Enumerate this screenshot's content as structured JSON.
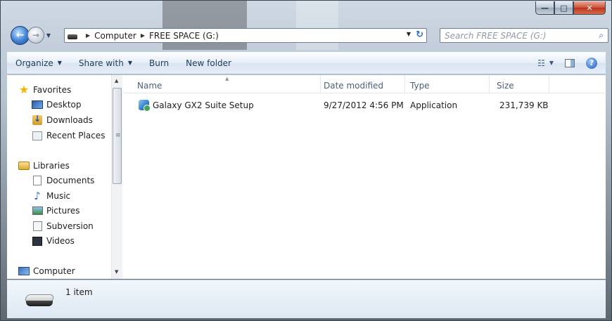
{
  "window": {
    "minimize_glyph": "—",
    "maximize_glyph": "□",
    "close_glyph": "✕"
  },
  "navigation": {
    "back_glyph": "←",
    "forward_glyph": "→",
    "dropdown_glyph": "▼"
  },
  "address": {
    "crumbs": [
      "Computer",
      "FREE SPACE (G:)"
    ],
    "separator": "▶",
    "dropdown_glyph": "▼",
    "refresh_glyph": "↻"
  },
  "search": {
    "placeholder": "Search FREE SPACE (G:)",
    "icon": "search-icon",
    "glyph": "⌕"
  },
  "toolbar": {
    "organize": "Organize",
    "share_with": "Share with",
    "burn": "Burn",
    "new_folder": "New folder",
    "dropdown_glyph": "▼",
    "views_glyph": "☷",
    "help_glyph": "?"
  },
  "nav_pane": {
    "favorites": "Favorites",
    "desktop": "Desktop",
    "downloads": "Downloads",
    "recent_places": "Recent Places",
    "libraries": "Libraries",
    "documents": "Documents",
    "music": "Music",
    "pictures": "Pictures",
    "subversion": "Subversion",
    "videos": "Videos",
    "computer": "Computer",
    "music_glyph": "♪",
    "favorites_glyph": "★"
  },
  "scrollbar": {
    "up_glyph": "▲",
    "down_glyph": "▼",
    "grip_glyph": "≡"
  },
  "columns": {
    "name": "Name",
    "date_modified": "Date modified",
    "type": "Type",
    "size": "Size",
    "sort_glyph": "▲"
  },
  "files": [
    {
      "name": "Galaxy GX2 Suite Setup",
      "date_modified": "9/27/2012 4:56 PM",
      "type": "Application",
      "size": "231,739 KB"
    }
  ],
  "details": {
    "item_count": "1 item"
  },
  "colors": {
    "accent": "#2f6bc7",
    "close_button": "#cf4e35",
    "toolbar_text": "#1e3b5f"
  }
}
